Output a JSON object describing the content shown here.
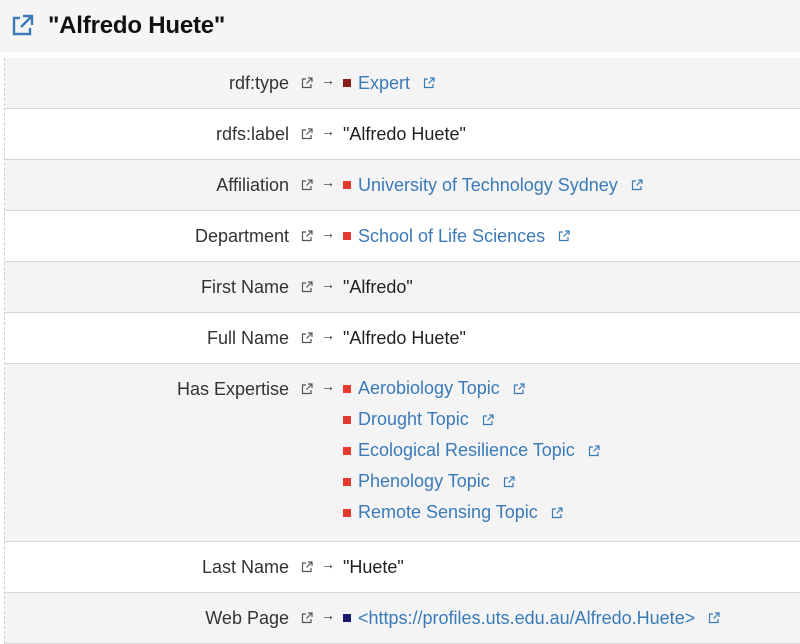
{
  "title": "\"Alfredo Huete\"",
  "colors": {
    "link": "#3a7ab8",
    "marker_red": "#e23a2e",
    "marker_darkred": "#8b1a1a",
    "marker_navy": "#1a1a6e"
  },
  "arrow": "→",
  "rows": [
    {
      "label": "rdf:type",
      "values": [
        {
          "text": "Expert",
          "kind": "link",
          "marker": "#8b1a1a"
        }
      ]
    },
    {
      "label": "rdfs:label",
      "values": [
        {
          "text": "\"Alfredo Huete\"",
          "kind": "literal"
        }
      ]
    },
    {
      "label": "Affiliation",
      "values": [
        {
          "text": "University of Technology Sydney",
          "kind": "link",
          "marker": "#e23a2e"
        }
      ]
    },
    {
      "label": "Department",
      "values": [
        {
          "text": "School of Life Sciences",
          "kind": "link",
          "marker": "#e23a2e"
        }
      ]
    },
    {
      "label": "First Name",
      "values": [
        {
          "text": "\"Alfredo\"",
          "kind": "literal"
        }
      ]
    },
    {
      "label": "Full Name",
      "values": [
        {
          "text": "\"Alfredo Huete\"",
          "kind": "literal"
        }
      ]
    },
    {
      "label": "Has Expertise",
      "values": [
        {
          "text": "Aerobiology Topic",
          "kind": "link",
          "marker": "#e23a2e"
        },
        {
          "text": "Drought Topic",
          "kind": "link",
          "marker": "#e23a2e"
        },
        {
          "text": "Ecological Resilience Topic",
          "kind": "link",
          "marker": "#e23a2e"
        },
        {
          "text": "Phenology Topic",
          "kind": "link",
          "marker": "#e23a2e"
        },
        {
          "text": "Remote Sensing Topic",
          "kind": "link",
          "marker": "#e23a2e"
        }
      ]
    },
    {
      "label": "Last Name",
      "values": [
        {
          "text": "\"Huete\"",
          "kind": "literal"
        }
      ]
    },
    {
      "label": "Web Page",
      "values": [
        {
          "text": "<https://profiles.uts.edu.au/Alfredo.Huete>",
          "kind": "link",
          "marker": "#1a1a6e"
        }
      ]
    }
  ]
}
